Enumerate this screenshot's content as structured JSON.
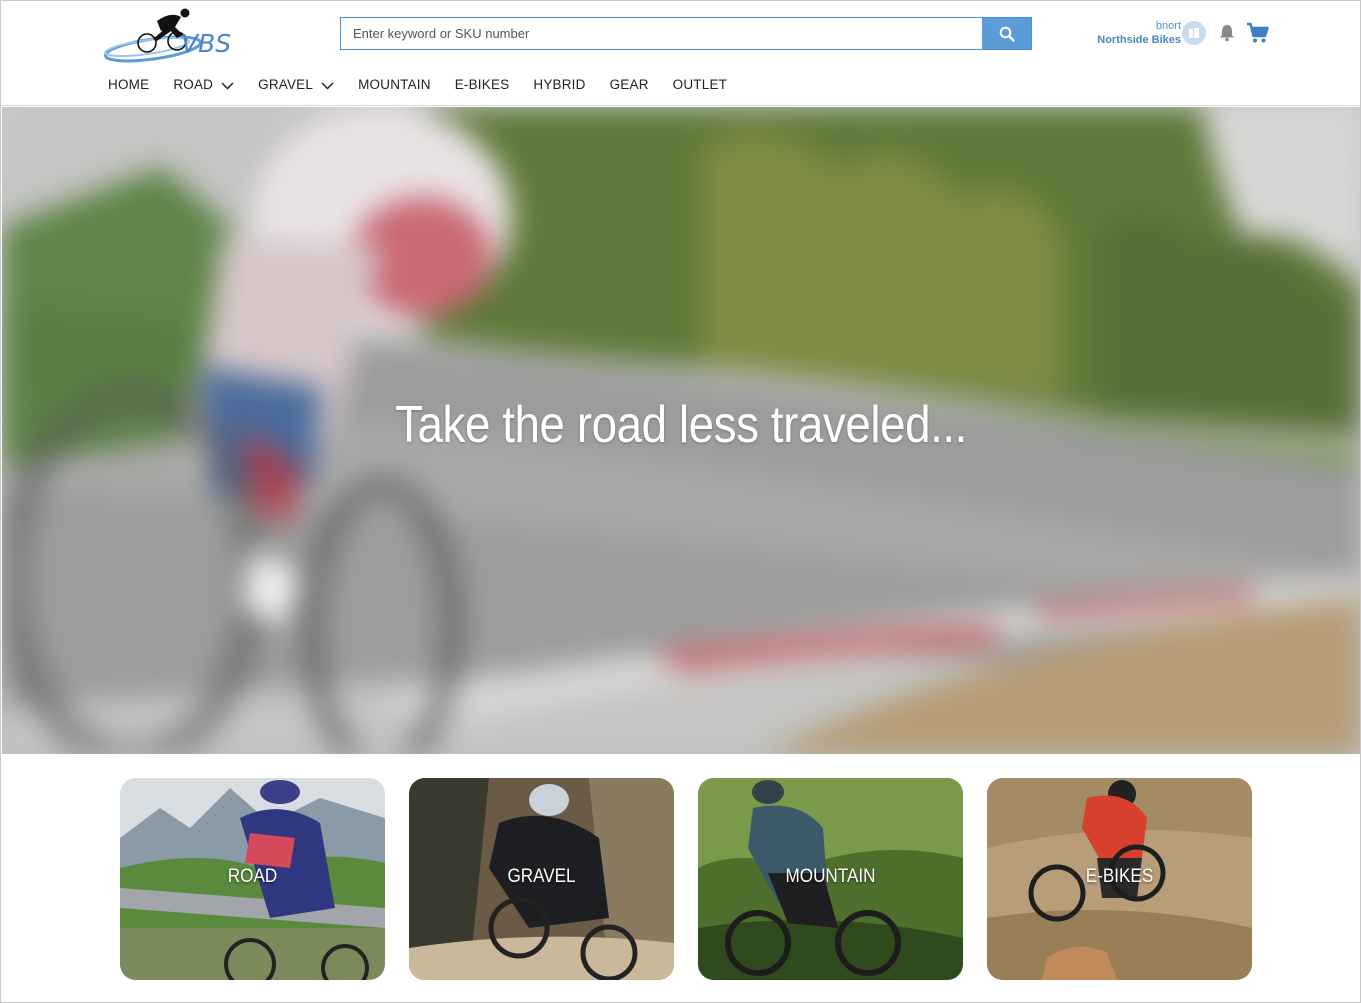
{
  "brand": {
    "logo_text": "VBS",
    "accent": "#4a90d9"
  },
  "search": {
    "placeholder": "Enter keyword or SKU number",
    "button_icon": "search-icon"
  },
  "account": {
    "username": "bnort",
    "store": "Northside Bikes",
    "avatar_icon": "store-icon",
    "notifications_icon": "bell-icon",
    "cart_icon": "cart-icon"
  },
  "nav": {
    "items": [
      {
        "label": "HOME",
        "has_dropdown": false
      },
      {
        "label": "ROAD",
        "has_dropdown": true
      },
      {
        "label": "GRAVEL",
        "has_dropdown": true
      },
      {
        "label": "MOUNTAIN",
        "has_dropdown": false
      },
      {
        "label": "E-BIKES",
        "has_dropdown": false
      },
      {
        "label": "HYBRID",
        "has_dropdown": false
      },
      {
        "label": "GEAR",
        "has_dropdown": false
      },
      {
        "label": "OUTLET",
        "has_dropdown": false
      }
    ]
  },
  "hero": {
    "title": "Take the road less traveled..."
  },
  "categories": [
    {
      "label": "ROAD"
    },
    {
      "label": "GRAVEL"
    },
    {
      "label": "MOUNTAIN"
    },
    {
      "label": "E-BIKES"
    }
  ]
}
